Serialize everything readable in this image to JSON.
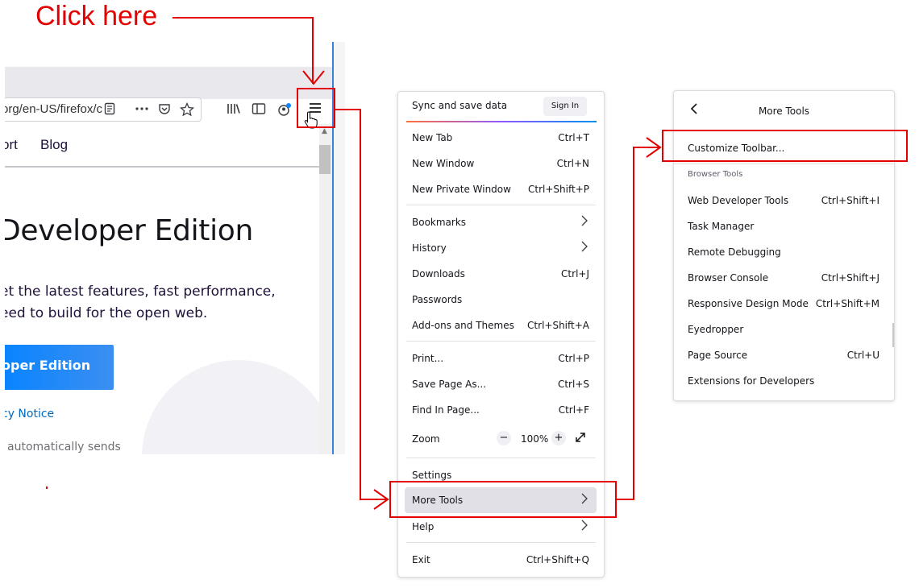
{
  "annotation": {
    "click_here": "Click here"
  },
  "browser": {
    "url_fragment": "org/en-US/firefox/c",
    "nav_links": [
      "ort",
      "Blog"
    ],
    "hero_title": "Developer Edition",
    "hero_desc_1": "et the latest features, fast performance,",
    "hero_desc_2": "eed to build for the open web.",
    "hero_button": "oper Edition",
    "notice": "cy Notice",
    "autosends": "automatically sends"
  },
  "main_menu": {
    "sync_label": "Sync and save data",
    "sign_in": "Sign In",
    "items_a": [
      {
        "label": "New Tab",
        "shortcut": "Ctrl+T"
      },
      {
        "label": "New Window",
        "shortcut": "Ctrl+N"
      },
      {
        "label": "New Private Window",
        "shortcut": "Ctrl+Shift+P"
      }
    ],
    "items_b": [
      {
        "label": "Bookmarks",
        "shortcut": ""
      },
      {
        "label": "History",
        "shortcut": ""
      },
      {
        "label": "Downloads",
        "shortcut": "Ctrl+J"
      },
      {
        "label": "Passwords",
        "shortcut": ""
      },
      {
        "label": "Add-ons and Themes",
        "shortcut": "Ctrl+Shift+A"
      }
    ],
    "items_c": [
      {
        "label": "Print...",
        "shortcut": "Ctrl+P"
      },
      {
        "label": "Save Page As...",
        "shortcut": "Ctrl+S"
      },
      {
        "label": "Find In Page...",
        "shortcut": "Ctrl+F"
      }
    ],
    "zoom": {
      "label": "Zoom",
      "minus": "−",
      "value": "100%",
      "plus": "+"
    },
    "settings": "Settings",
    "more_tools": "More Tools",
    "help": "Help",
    "exit": {
      "label": "Exit",
      "shortcut": "Ctrl+Shift+Q"
    }
  },
  "more_tools_panel": {
    "title": "More Tools",
    "customize": "Customize Toolbar...",
    "group_label": "Browser Tools",
    "items": [
      {
        "label": "Web Developer Tools",
        "shortcut": "Ctrl+Shift+I"
      },
      {
        "label": "Task Manager",
        "shortcut": ""
      },
      {
        "label": "Remote Debugging",
        "shortcut": ""
      },
      {
        "label": "Browser Console",
        "shortcut": "Ctrl+Shift+J"
      },
      {
        "label": "Responsive Design Mode",
        "shortcut": "Ctrl+Shift+M"
      },
      {
        "label": "Eyedropper",
        "shortcut": ""
      },
      {
        "label": "Page Source",
        "shortcut": "Ctrl+U"
      },
      {
        "label": "Extensions for Developers",
        "shortcut": ""
      }
    ]
  },
  "colors": {
    "annotation_red": "#e30000",
    "accent_blue": "#0a84ff"
  }
}
